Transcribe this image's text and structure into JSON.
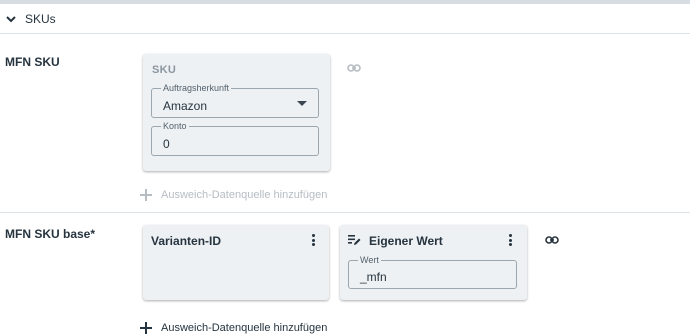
{
  "section": {
    "title": "SKUs",
    "chevron_icon": "chevron-down-icon"
  },
  "mfn_sku": {
    "label": "MFN SKU",
    "card": {
      "title": "SKU",
      "order_source": {
        "label": "Auftragsherkunft",
        "value": "Amazon"
      },
      "account": {
        "label": "Konto",
        "value": "0"
      }
    },
    "link_icon": "link-icon",
    "add_fallback": "Ausweich-Datenquelle hinzufügen"
  },
  "mfn_sku_base": {
    "label": "MFN SKU base*",
    "variant_card": {
      "title": "Varianten-ID"
    },
    "custom_card": {
      "title": "Eigener Wert",
      "icon": "edit-list-icon",
      "value_field": {
        "label": "Wert",
        "value": "_mfn"
      }
    },
    "link_icon": "link-icon",
    "add_fallback": "Ausweich-Datenquelle hinzufügen"
  },
  "colors": {
    "card_bg": "#eef1f4",
    "text": "#26343f",
    "muted_text": "#b6bdc3",
    "divider": "#dde2e6"
  }
}
